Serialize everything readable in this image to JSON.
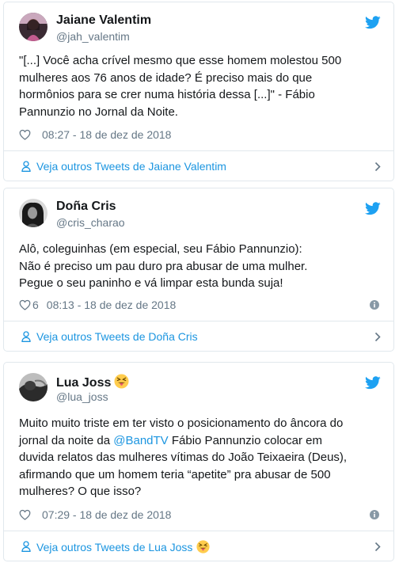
{
  "tweets": [
    {
      "display_name": "Jaiane Valentim",
      "handle": "@jah_valentim",
      "text_lines": [
        "\"[...] Você acha crível mesmo que esse homem molestou 500",
        "mulheres aos 76 anos de idade? É preciso mais do que",
        "hormônios para se crer numa história dessa [...]\" - Fábio",
        "Pannunzio no Jornal da Noite."
      ],
      "likes": "",
      "timestamp": "08:27 - 18 de dez de 2018",
      "footer_link": "Veja outros Tweets de Jaiane Valentim"
    },
    {
      "display_name": "Doña Cris",
      "handle": "@cris_charao",
      "text_lines": [
        "Alô, coleguinhas (em especial, seu Fábio Pannunzio):",
        "Não é preciso um pau duro pra abusar de uma mulher.",
        "Pegue o seu paninho e vá limpar esta bunda suja!"
      ],
      "likes": "6",
      "timestamp": "08:13 - 18 de dez de 2018",
      "footer_link": "Veja outros Tweets de Doña Cris"
    },
    {
      "display_name": "Lua Joss",
      "handle": "@lua_joss",
      "text_line1": "Muito muito triste em ter visto o posicionamento do âncora do",
      "text_line2_pre": "jornal da noite da ",
      "mention": "@BandTV",
      "text_line2_post": " Fábio Pannunzio colocar em",
      "text_lines_rest": [
        "duvida relatos das mulheres vítimas do João Teixaeira (Deus),",
        "afirmando que um homem teria “apetite” pra abusar de 500",
        "mulheres? O que isso?"
      ],
      "likes": "",
      "timestamp": "07:29 - 18 de dez de 2018",
      "footer_link": "Veja outros Tweets de Lua Joss"
    }
  ],
  "icons": {
    "brand_twitter": "twitter-bird-icon",
    "like": "heart-icon",
    "info": "info-icon",
    "profile": "person-icon",
    "chevron": "chevron-right-icon",
    "emoji": "squinting-face-with-tongue-emoji"
  },
  "colors": {
    "twitter_blue": "#1da1f2",
    "link_blue": "#1b95e0",
    "text": "#14171a",
    "secondary_text": "#657786",
    "border": "#e1e8ed",
    "emoji_yellow": "#ffcc4d",
    "tongue": "#e8596e"
  }
}
